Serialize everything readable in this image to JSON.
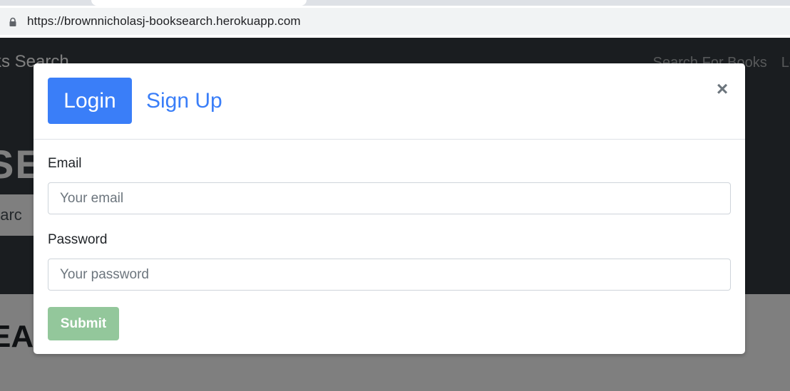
{
  "browser": {
    "url": "https://brownnicholasj-booksearch.herokuapp.com"
  },
  "background_page": {
    "brand": "ks Search",
    "nav_links": [
      "Search For Books",
      "Lo"
    ],
    "hero_heading": "SE",
    "hero_search_placeholder": "earc",
    "results_heading": "EA"
  },
  "modal": {
    "tabs": {
      "login": "Login",
      "signup": "Sign Up"
    },
    "close_glyph": "×",
    "email": {
      "label": "Email",
      "placeholder": "Your email",
      "value": ""
    },
    "password": {
      "label": "Password",
      "placeholder": "Your password",
      "value": ""
    },
    "submit_label": "Submit",
    "submit_disabled": true
  },
  "colors": {
    "primary": "#3a7ef8",
    "submit_disabled": "#93c79b",
    "navbar": "#343a40",
    "backdrop": "rgba(0,0,0,0.5)"
  },
  "icons": {
    "address_bar": "lock-icon",
    "modal_close": "close-icon"
  }
}
